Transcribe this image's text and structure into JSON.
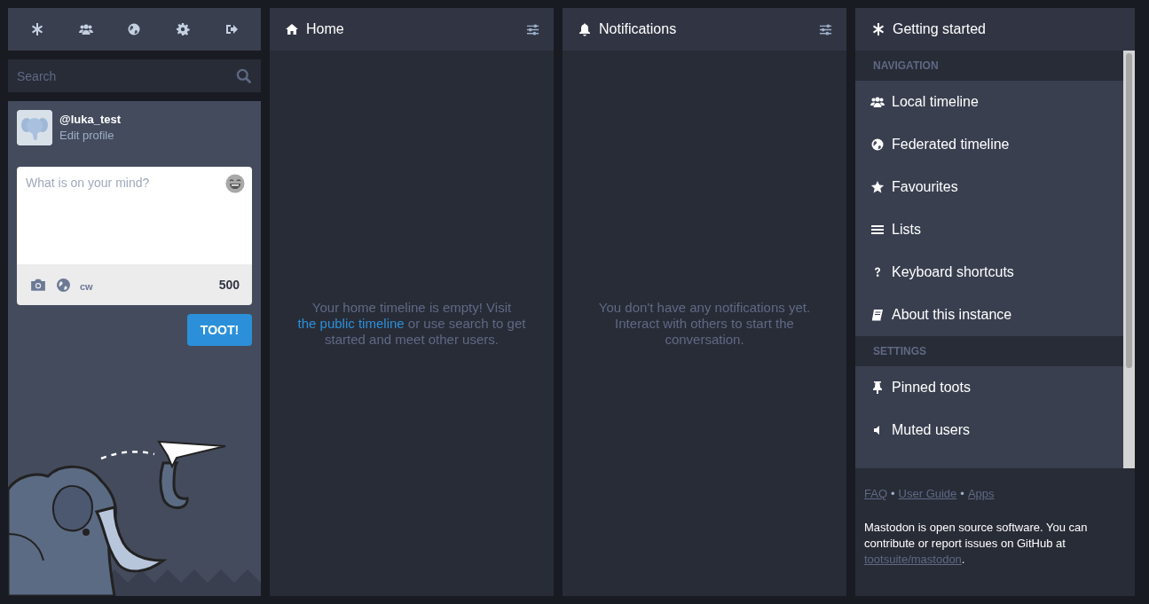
{
  "search": {
    "placeholder": "Search"
  },
  "profile": {
    "handle": "@luka_test",
    "edit_link": "Edit profile"
  },
  "compose": {
    "placeholder": "What is on your mind?",
    "cw_label": "cw",
    "char_count": "500",
    "submit": "TOOT!"
  },
  "columns": [
    {
      "kind": "home",
      "title": "Home",
      "message": {
        "before": "Your home timeline is empty! Visit ",
        "link": "the public timeline",
        "after": " or use search to get started and meet other users."
      }
    },
    {
      "kind": "notifications",
      "title": "Notifications",
      "message": {
        "before": "You don't have any notifications yet. Interact with others to start the conversation."
      }
    }
  ],
  "getting_started": {
    "title": "Getting started",
    "sections": [
      {
        "heading": "NAVIGATION",
        "items": [
          {
            "label": "Local timeline"
          },
          {
            "label": "Federated timeline"
          },
          {
            "label": "Favourites"
          },
          {
            "label": "Lists"
          },
          {
            "label": "Keyboard shortcuts"
          },
          {
            "label": "About this instance"
          }
        ]
      },
      {
        "heading": "SETTINGS",
        "items": [
          {
            "label": "Pinned toots"
          },
          {
            "label": "Muted users"
          }
        ]
      }
    ],
    "footer": {
      "links": [
        "FAQ",
        "User Guide",
        "Apps"
      ],
      "separator": "•",
      "about": {
        "before": "Mastodon is open source software. You can contribute or report issues on GitHub at ",
        "link": "tootsuite/mastodon",
        "after": "."
      }
    }
  }
}
